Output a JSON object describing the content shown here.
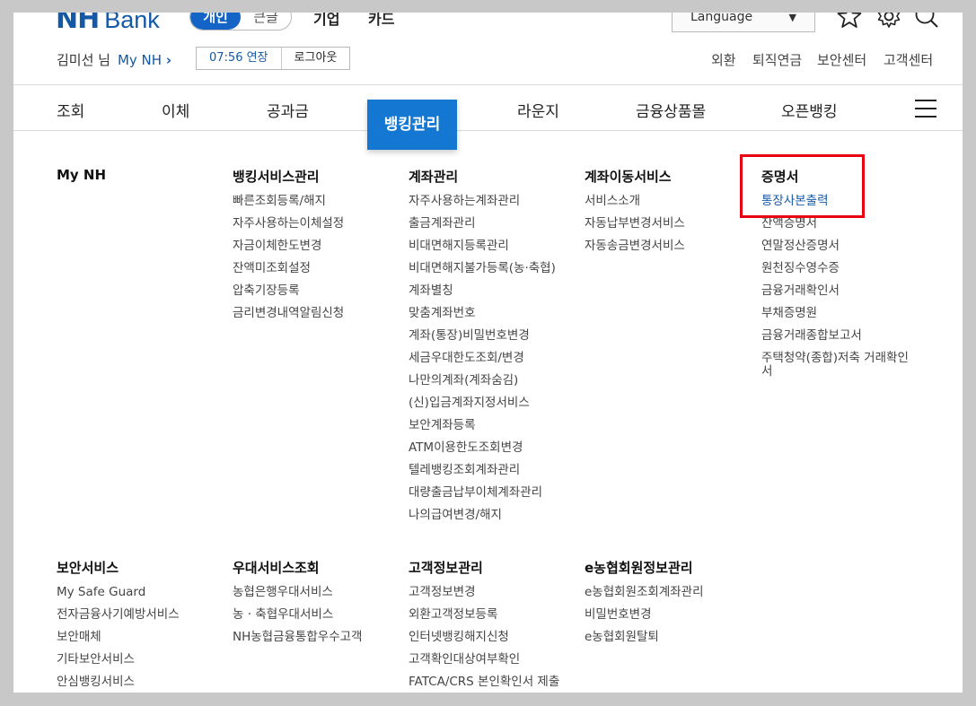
{
  "header": {
    "logo_nh": "NH",
    "logo_bank": "Bank",
    "segment": {
      "active": "개인",
      "inactive": "큰글"
    },
    "top_links": [
      "기업",
      "카드"
    ],
    "language": "Language",
    "icons": [
      "star-icon",
      "gear-icon",
      "search-icon"
    ]
  },
  "user": {
    "greeting": "김미선 님",
    "my_nh": "My NH",
    "timer": "07:56 연장",
    "logout": "로그아웃"
  },
  "util_links": [
    "외환",
    "퇴직연금",
    "보안센터",
    "고객센터"
  ],
  "gnb": {
    "items": [
      "조회",
      "이체",
      "공과금",
      "뱅킹관리",
      "라운지",
      "금융상품몰",
      "오픈뱅킹"
    ],
    "active": "뱅킹관리"
  },
  "menu": {
    "my_nh": {
      "title": "My NH",
      "items": []
    },
    "banking_service": {
      "title": "뱅킹서비스관리",
      "items": [
        "빠른조회등록/해지",
        "자주사용하는이체설정",
        "자금이체한도변경",
        "잔액미조회설정",
        "압축기장등록",
        "금리변경내역알림신청"
      ]
    },
    "account": {
      "title": "계좌관리",
      "items": [
        "자주사용하는계좌관리",
        "출금계좌관리",
        "비대면해지등록관리",
        "비대면해지불가등록(농·축협)",
        "계좌별칭",
        "맞춤계좌번호",
        "계좌(통장)비밀번호변경",
        "세금우대한도조회/변경",
        "나만의계좌(계좌숨김)",
        "(신)입금계좌지정서비스",
        "보안계좌등록",
        "ATM이용한도조회변경",
        "텔레뱅킹조회계좌관리",
        "대량출금납부이체계좌관리",
        "나의급여변경/해지"
      ]
    },
    "account_move": {
      "title": "계좌이동서비스",
      "items": [
        "서비스소개",
        "자동납부변경서비스",
        "자동송금변경서비스"
      ]
    },
    "certificate": {
      "title": "증명서",
      "items": [
        "통장사본출력",
        "잔액증명서",
        "연말정산증명서",
        "원천징수영수증",
        "금융거래확인서",
        "부채증명원",
        "금융거래종합보고서",
        "주택청약(종합)저축 거래확인서"
      ]
    },
    "security": {
      "title": "보안서비스",
      "items": [
        "My Safe Guard",
        "전자금융사기예방서비스",
        "보안매체",
        "기타보안서비스",
        "안심뱅킹서비스"
      ]
    },
    "preferential": {
      "title": "우대서비스조회",
      "items": [
        "농협은행우대서비스",
        "농 · 축협우대서비스",
        "NH농협금융통합우수고객"
      ]
    },
    "customer_info": {
      "title": "고객정보관리",
      "items": [
        "고객정보변경",
        "외환고객정보등록",
        "인터넷뱅킹해지신청",
        "고객확인대상여부확인",
        "FATCA/CRS 본인확인서 제출"
      ]
    },
    "e_member": {
      "title": "e농협회원정보관리",
      "items": [
        "e농협회원조회계좌관리",
        "비밀번호변경",
        "e농협회원탈퇴"
      ]
    }
  },
  "colors": {
    "brand": "#1459a8",
    "active_tab": "#1478d2",
    "highlight_box": "#e60012"
  }
}
